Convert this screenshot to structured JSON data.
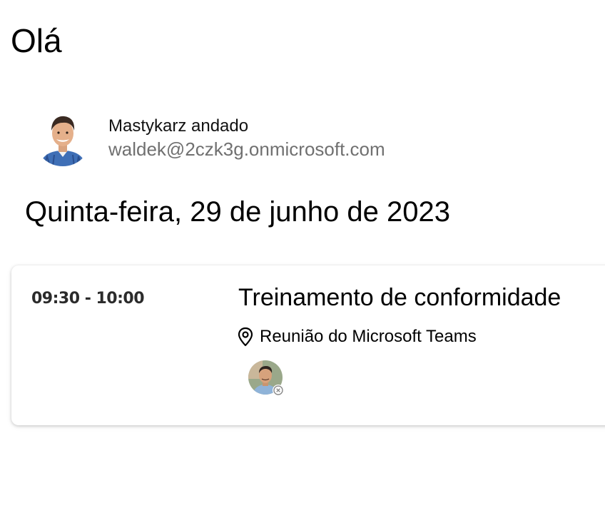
{
  "greeting": "Olá",
  "user": {
    "name": "Mastykarz andado",
    "email": "waldek@2czk3g.onmicrosoft.com",
    "avatar_icon": "user-photo"
  },
  "date_heading": "Quinta-feira, 29 de junho de 2023",
  "event": {
    "time": "09:30 - 10:00",
    "title": "Treinamento de conformidade",
    "location": "Reunião do Microsoft Teams",
    "location_icon": "location-pin-icon",
    "attendee_status_icon": "declined-status-icon"
  },
  "colors": {
    "secondary_text": "#707070",
    "card_background": "#ffffff"
  }
}
